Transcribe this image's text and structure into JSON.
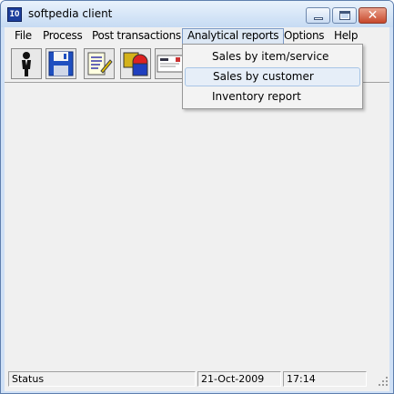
{
  "window": {
    "title": "softpedia client"
  },
  "menubar": {
    "items": [
      "File",
      "Process",
      "Post transactions",
      "Analytical reports",
      "Options",
      "Help"
    ]
  },
  "toolbar": {
    "buttons": [
      "person-icon",
      "save-icon",
      "document-edit-icon",
      "shapes-icon",
      "invoice-icon"
    ]
  },
  "dropdown": {
    "items": [
      "Sales by item/service",
      "Sales by customer",
      "Inventory report"
    ]
  },
  "status": {
    "text": "Status",
    "date": "21-Oct-2009",
    "time": "17:14"
  }
}
